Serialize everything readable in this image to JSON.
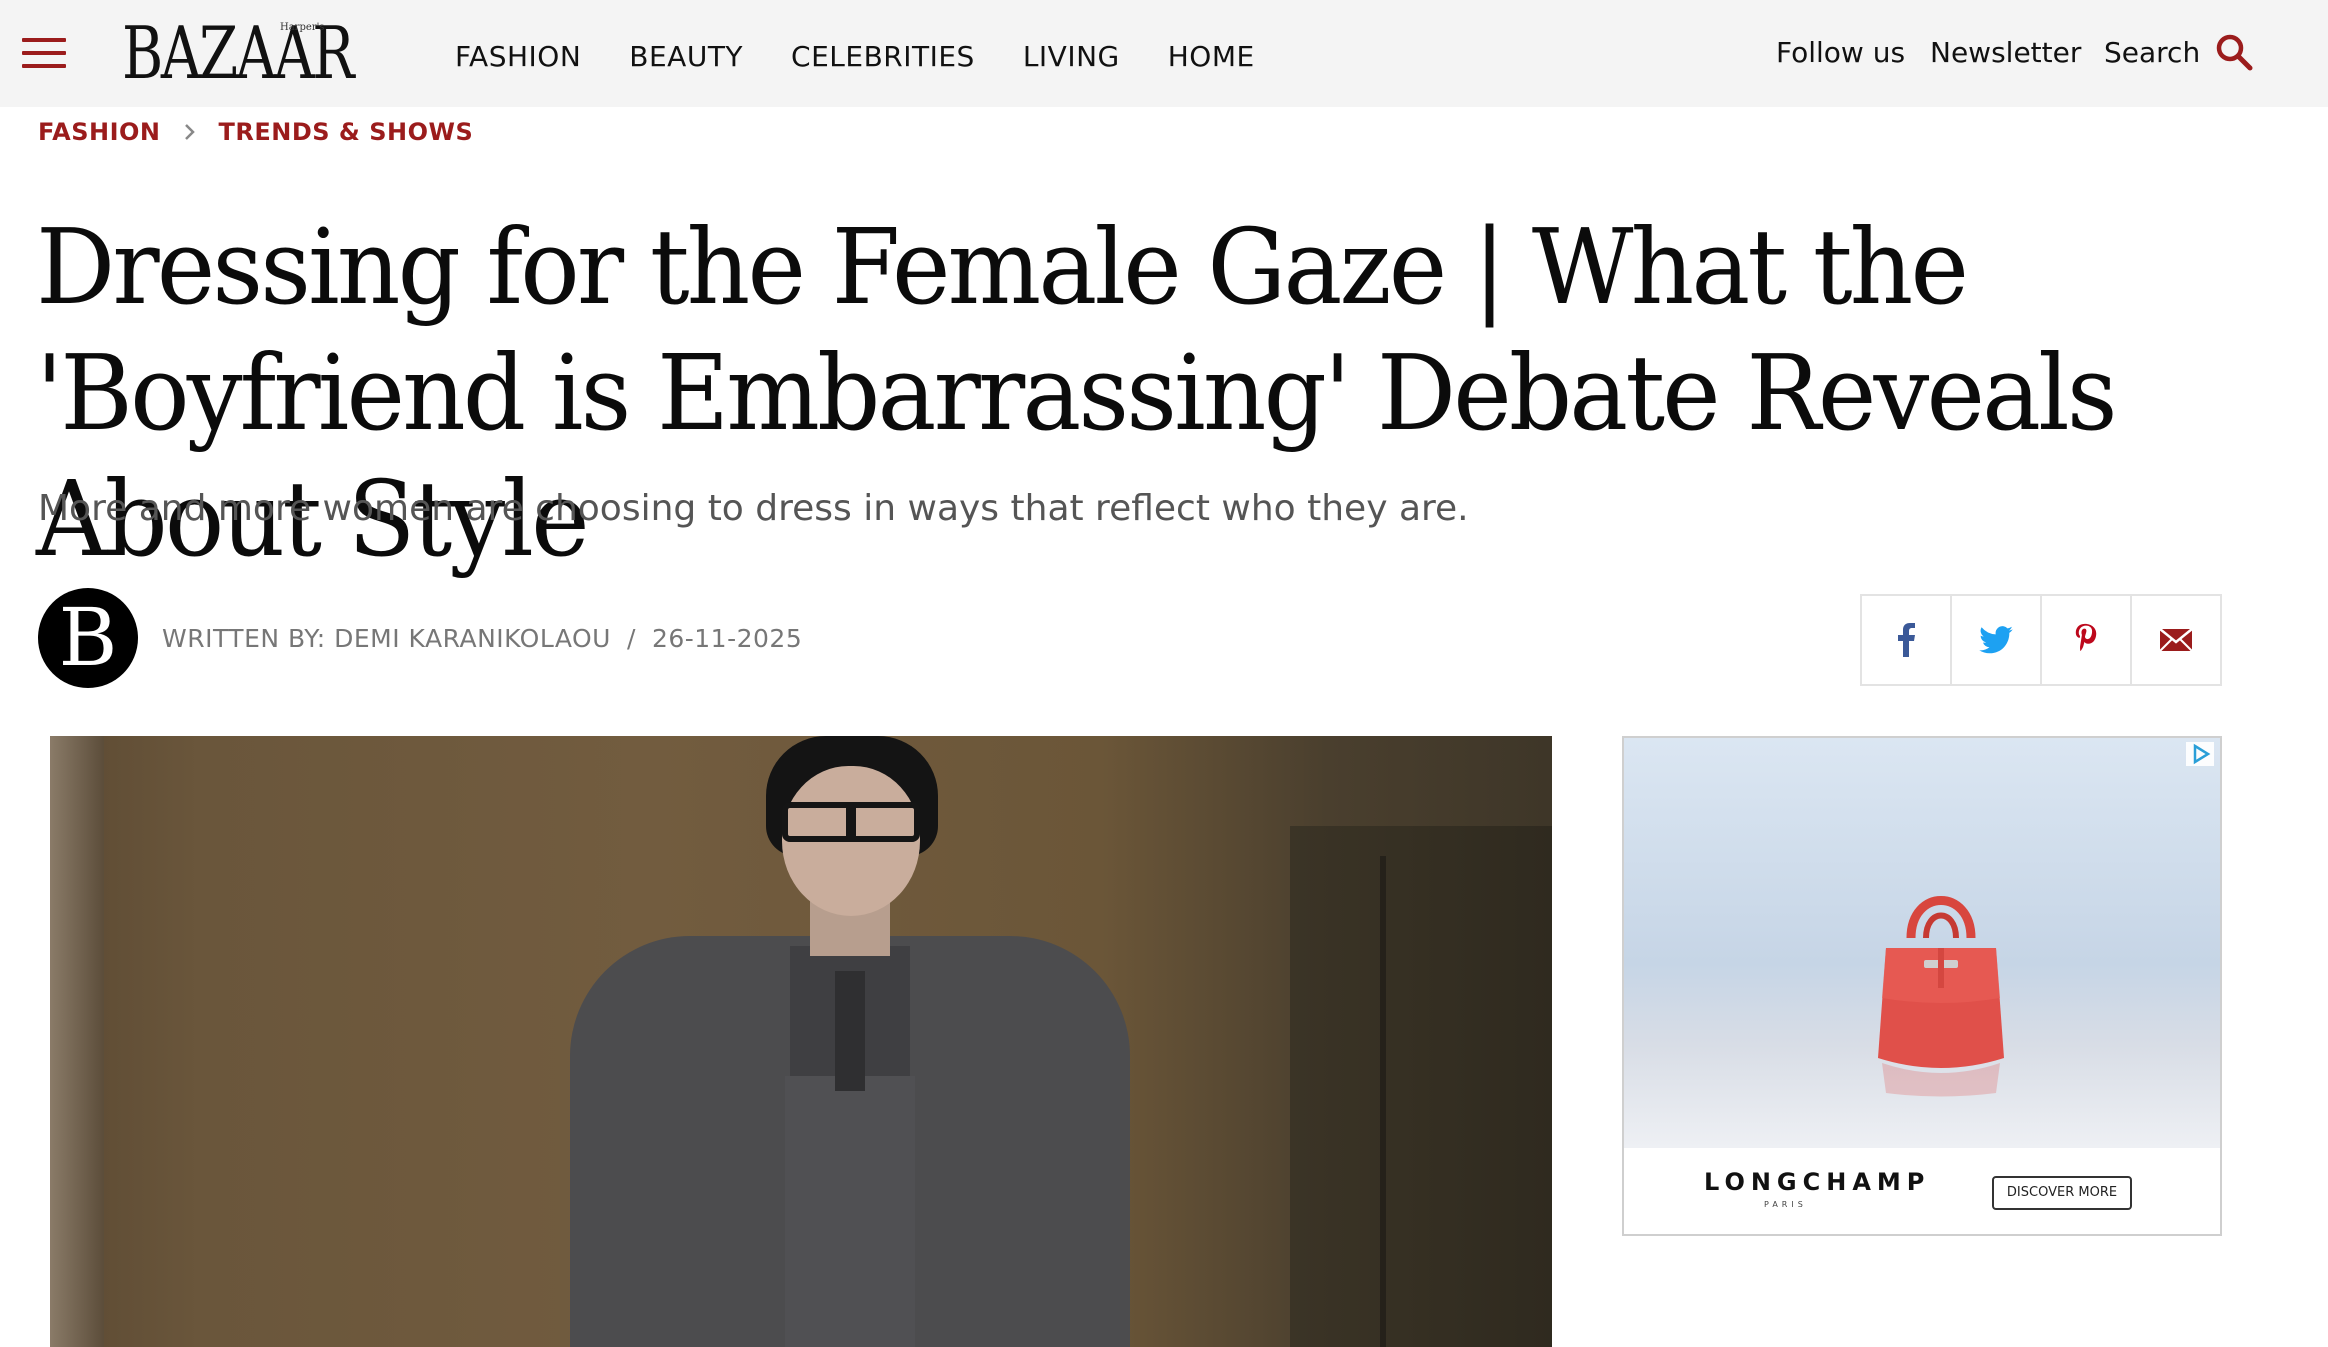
{
  "header": {
    "logo_text": "BAZAAR",
    "logo_small": "Harper's",
    "nav": [
      {
        "label": "FASHION"
      },
      {
        "label": "BEAUTY"
      },
      {
        "label": "CELEBRITIES"
      },
      {
        "label": "LIVING"
      },
      {
        "label": "HOME"
      }
    ],
    "follow_label": "Follow us",
    "newsletter_label": "Newsletter",
    "search_label": "Search"
  },
  "breadcrumb": [
    {
      "label": "FASHION"
    },
    {
      "label": "TRENDS & SHOWS"
    }
  ],
  "article": {
    "title": "Dressing for the Female Gaze | What the 'Boyfriend is Embarrassing' Debate Reveals About Style",
    "subtitle": "More and more women are choosing to dress in ways that reflect who they are.",
    "avatar_letter": "B",
    "byline": "WRITTEN BY: DEMI KARANIKOLAOU",
    "byline_sep": "/",
    "date": "26-11-2025"
  },
  "share": [
    {
      "icon": "facebook-icon"
    },
    {
      "icon": "twitter-icon"
    },
    {
      "icon": "pinterest-icon"
    },
    {
      "icon": "email-icon"
    }
  ],
  "ad": {
    "brand": "LONGCHAMP",
    "brand_sub": "PARIS",
    "cta": "DISCOVER MORE"
  },
  "colors": {
    "accent": "#9b1c1c",
    "facebook": "#3b5998",
    "twitter": "#1da1f2",
    "pinterest": "#bd081c",
    "email": "#9b1c1c"
  }
}
